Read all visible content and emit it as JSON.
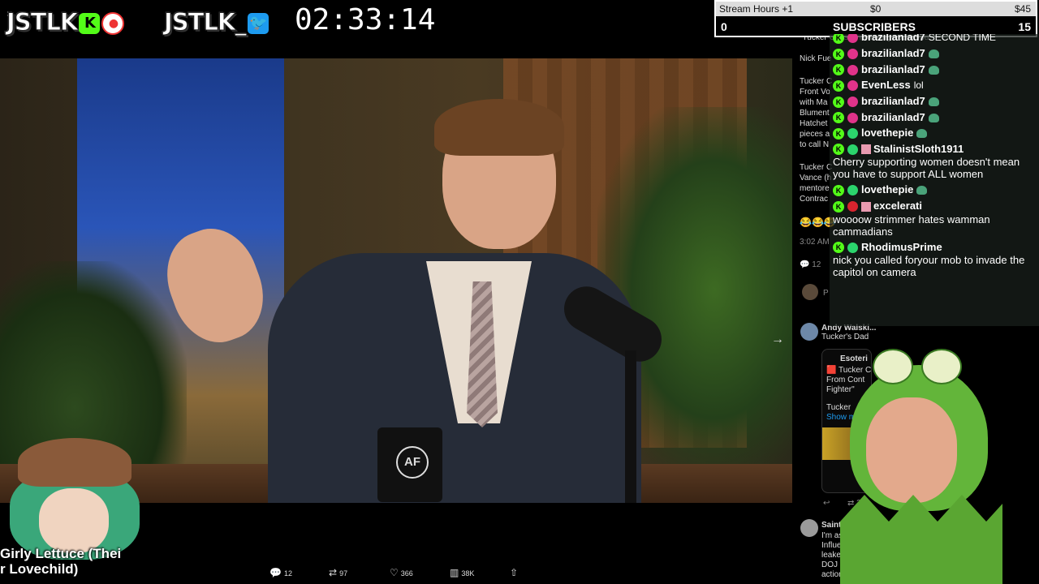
{
  "overlay": {
    "kick_brand": "JSTLK",
    "twitter_brand": "JSTLK_",
    "timer": "02:33:14"
  },
  "stream_hours": {
    "label": "Stream Hours +1",
    "mid_value": "$0",
    "end_value": "$45",
    "subscriber_count": "0",
    "subscribers_label": "SUBSCRIBERS",
    "subscriber_goal": "15"
  },
  "video": {
    "mug_logo": "AF"
  },
  "tweet_panel": {
    "quote_header": "\"Tucker Carlson is asking about you.\"",
    "nick_line": "Nick Fue",
    "body_lines": [
      "Tucker C",
      "Front Vo",
      "with Ma",
      "Blument",
      "Hatchet",
      "pieces a",
      "to call N"
    ],
    "body_lines2": [
      "Tucker C",
      "Vance (h",
      "mentore",
      "Contrac"
    ],
    "emoji_row": "😂😂😂",
    "time": "3:02 AM",
    "reply_count": "12",
    "p_line": "P",
    "author": "Andy Walski...",
    "author_sub": "Tucker's Dad",
    "quote_author": "Esoteri",
    "quote_lines": [
      "🟥 Tucker C",
      "From Cont",
      "Fighter\"",
      "",
      "Tucker",
      "Show m"
    ],
    "retweet_count": "2",
    "saint_author": "Saint of",
    "saint_lines": [
      "I'm assi",
      "Influe",
      "leake",
      "DOJ",
      "action ag"
    ]
  },
  "chat": {
    "messages": [
      {
        "user": "brazilianlad7",
        "color": "#e0338a",
        "text": "SECOND TIME",
        "emote": false
      },
      {
        "user": "brazilianlad7",
        "color": "#e0338a",
        "text": "",
        "emote": true
      },
      {
        "user": "brazilianlad7",
        "color": "#e0338a",
        "text": "",
        "emote": true
      },
      {
        "user": "EvenLess",
        "color": "#e0338a",
        "text": "lol",
        "emote": false
      },
      {
        "user": "brazilianlad7",
        "color": "#e0338a",
        "text": "",
        "emote": true
      },
      {
        "user": "brazilianlad7",
        "color": "#e0338a",
        "text": "",
        "emote": true
      },
      {
        "user": "lovethepie",
        "color": "#2bd46c",
        "text": "",
        "emote": true
      },
      {
        "user": "StalinistSloth1911",
        "color": "#2bd46c",
        "text": "Cherry supporting women doesn't mean you have to support ALL women",
        "emote": false,
        "block": true
      },
      {
        "user": "lovethepie",
        "color": "#2bd46c",
        "text": "",
        "emote": true
      },
      {
        "user": "excelerati",
        "color": "#d8242e",
        "text": "woooow strimmer hates wamman cammadians",
        "emote": false,
        "block": true
      },
      {
        "user": "RhodimusPrime",
        "color": "#2bd46c",
        "text": "nick you called foryour mob to invade the capitol on camera",
        "emote": false,
        "block": true
      }
    ]
  },
  "tweet_actions": {
    "replies": "12",
    "retweets": "97",
    "likes": "366",
    "views": "38K"
  },
  "avatar_left": {
    "name": "Girly Lettuce (Thei\nr Lovechild)"
  }
}
